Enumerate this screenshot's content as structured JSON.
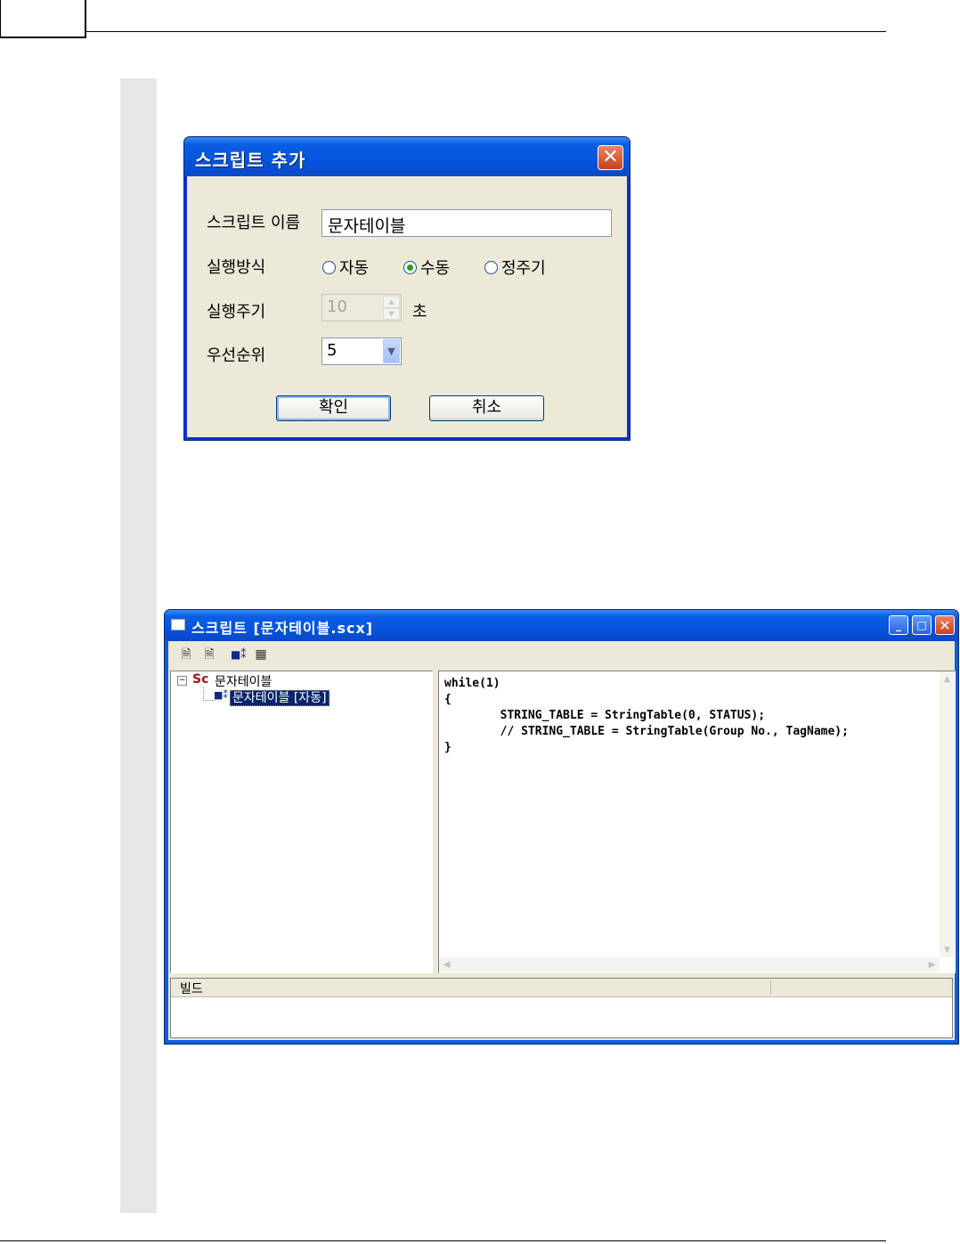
{
  "dialog": {
    "title": "스크립트 추가",
    "close_glyph": "✕",
    "name_label": "스크립트 이름",
    "name_value": "문자테이블",
    "exec_mode_label": "실행방식",
    "exec_modes": [
      {
        "label": "자동",
        "selected": false
      },
      {
        "label": "수동",
        "selected": true
      },
      {
        "label": "정주기",
        "selected": false
      }
    ],
    "period_label": "실행주기",
    "period_value": "10",
    "period_unit": "초",
    "priority_label": "우선순위",
    "priority_value": "5",
    "ok_label": "확인",
    "cancel_label": "취소"
  },
  "script_window": {
    "title": "스크립트 [문자테이블.scx]",
    "minimize_glyph": "_",
    "maximize_glyph": "□",
    "close_glyph": "✕",
    "toolbar_icons": [
      "new-script-icon",
      "document-icon",
      "tree-node-icon",
      "build-icon"
    ],
    "tree": {
      "root_badge": "Sc",
      "root_label": "문자테이블",
      "child_label": "문자테이블 [자동]"
    },
    "code": "while(1)\n{\n        STRING_TABLE = StringTable(0, STATUS);\n        // STRING_TABLE = StringTable(Group No., TagName);\n}",
    "build_label": "빌드"
  }
}
